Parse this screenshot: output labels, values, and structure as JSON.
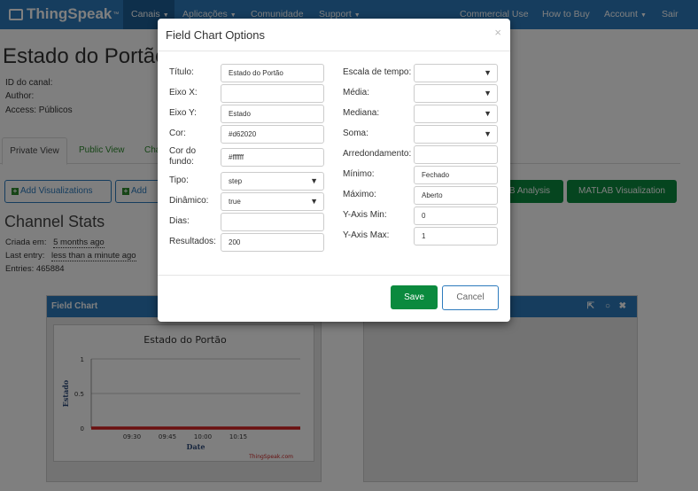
{
  "nav": {
    "logo": "ThingSpeak",
    "tm": "™",
    "items": [
      "Canais",
      "Aplicações",
      "Comunidade",
      "Support",
      "Commercial Use",
      "How to Buy",
      "Account",
      "Sair"
    ]
  },
  "page": {
    "title": "Estado do Portão",
    "info": [
      "ID do canal:",
      "Author:",
      "Access: Públicos"
    ]
  },
  "tabs": [
    "Private View",
    "Public View",
    "Cha"
  ],
  "buttons": {
    "add_viz": "Add Visualizations",
    "add2": "Add",
    "matlab_analysis": "B Analysis",
    "matlab_viz": "MATLAB Visualization"
  },
  "stats": {
    "title": "Channel Stats",
    "created_label": "Criada em:",
    "created_value": "5 months ago",
    "last_label": "Last entry:",
    "last_value": "less than a minute ago",
    "entries": "Entries: 465884"
  },
  "panel": {
    "title": "Field Chart"
  },
  "chart_data": {
    "type": "line",
    "title": "Estado do Portão",
    "xlabel": "Date",
    "ylabel": "Estado",
    "yticks": [
      "0",
      "0.5",
      "1"
    ],
    "xticks": [
      "09:30",
      "09:45",
      "10:00",
      "10:15"
    ],
    "ylim": [
      0,
      1
    ],
    "series": [
      {
        "values": [
          0,
          0,
          0,
          0,
          0,
          0,
          0,
          0,
          0,
          0
        ]
      }
    ],
    "color": "#d62020",
    "credit": "ThingSpeak.com"
  },
  "modal": {
    "title": "Field Chart Options",
    "close": "×",
    "save": "Save",
    "cancel": "Cancel",
    "left": [
      {
        "label": "Título:",
        "value": "Estado do Portão",
        "type": "input"
      },
      {
        "label": "Eixo X:",
        "value": "",
        "type": "input"
      },
      {
        "label": "Eixo Y:",
        "value": "Estado",
        "type": "input"
      },
      {
        "label": "Cor:",
        "value": "#d62020",
        "type": "input"
      },
      {
        "label": "Cor do fundo:",
        "value": "#ffffff",
        "type": "input"
      },
      {
        "label": "Tipo:",
        "value": "step",
        "type": "select"
      },
      {
        "label": "Dinâmico:",
        "value": "true",
        "type": "select"
      },
      {
        "label": "Dias:",
        "value": "",
        "type": "input"
      },
      {
        "label": "Resultados:",
        "value": "200",
        "type": "input"
      }
    ],
    "right": [
      {
        "label": "Escala de tempo:",
        "value": "",
        "type": "select"
      },
      {
        "label": "Média:",
        "value": "",
        "type": "select"
      },
      {
        "label": "Mediana:",
        "value": "",
        "type": "select"
      },
      {
        "label": "Soma:",
        "value": "",
        "type": "select"
      },
      {
        "label": "Arredondamento:",
        "value": "",
        "type": "input"
      },
      {
        "label": "Mínimo:",
        "value": "Fechado",
        "type": "input"
      },
      {
        "label": "Máximo:",
        "value": "Aberto",
        "type": "input"
      },
      {
        "label": "Y-Axis Min:",
        "value": "0",
        "type": "input"
      },
      {
        "label": "Y-Axis Max:",
        "value": "1",
        "type": "input"
      }
    ]
  }
}
